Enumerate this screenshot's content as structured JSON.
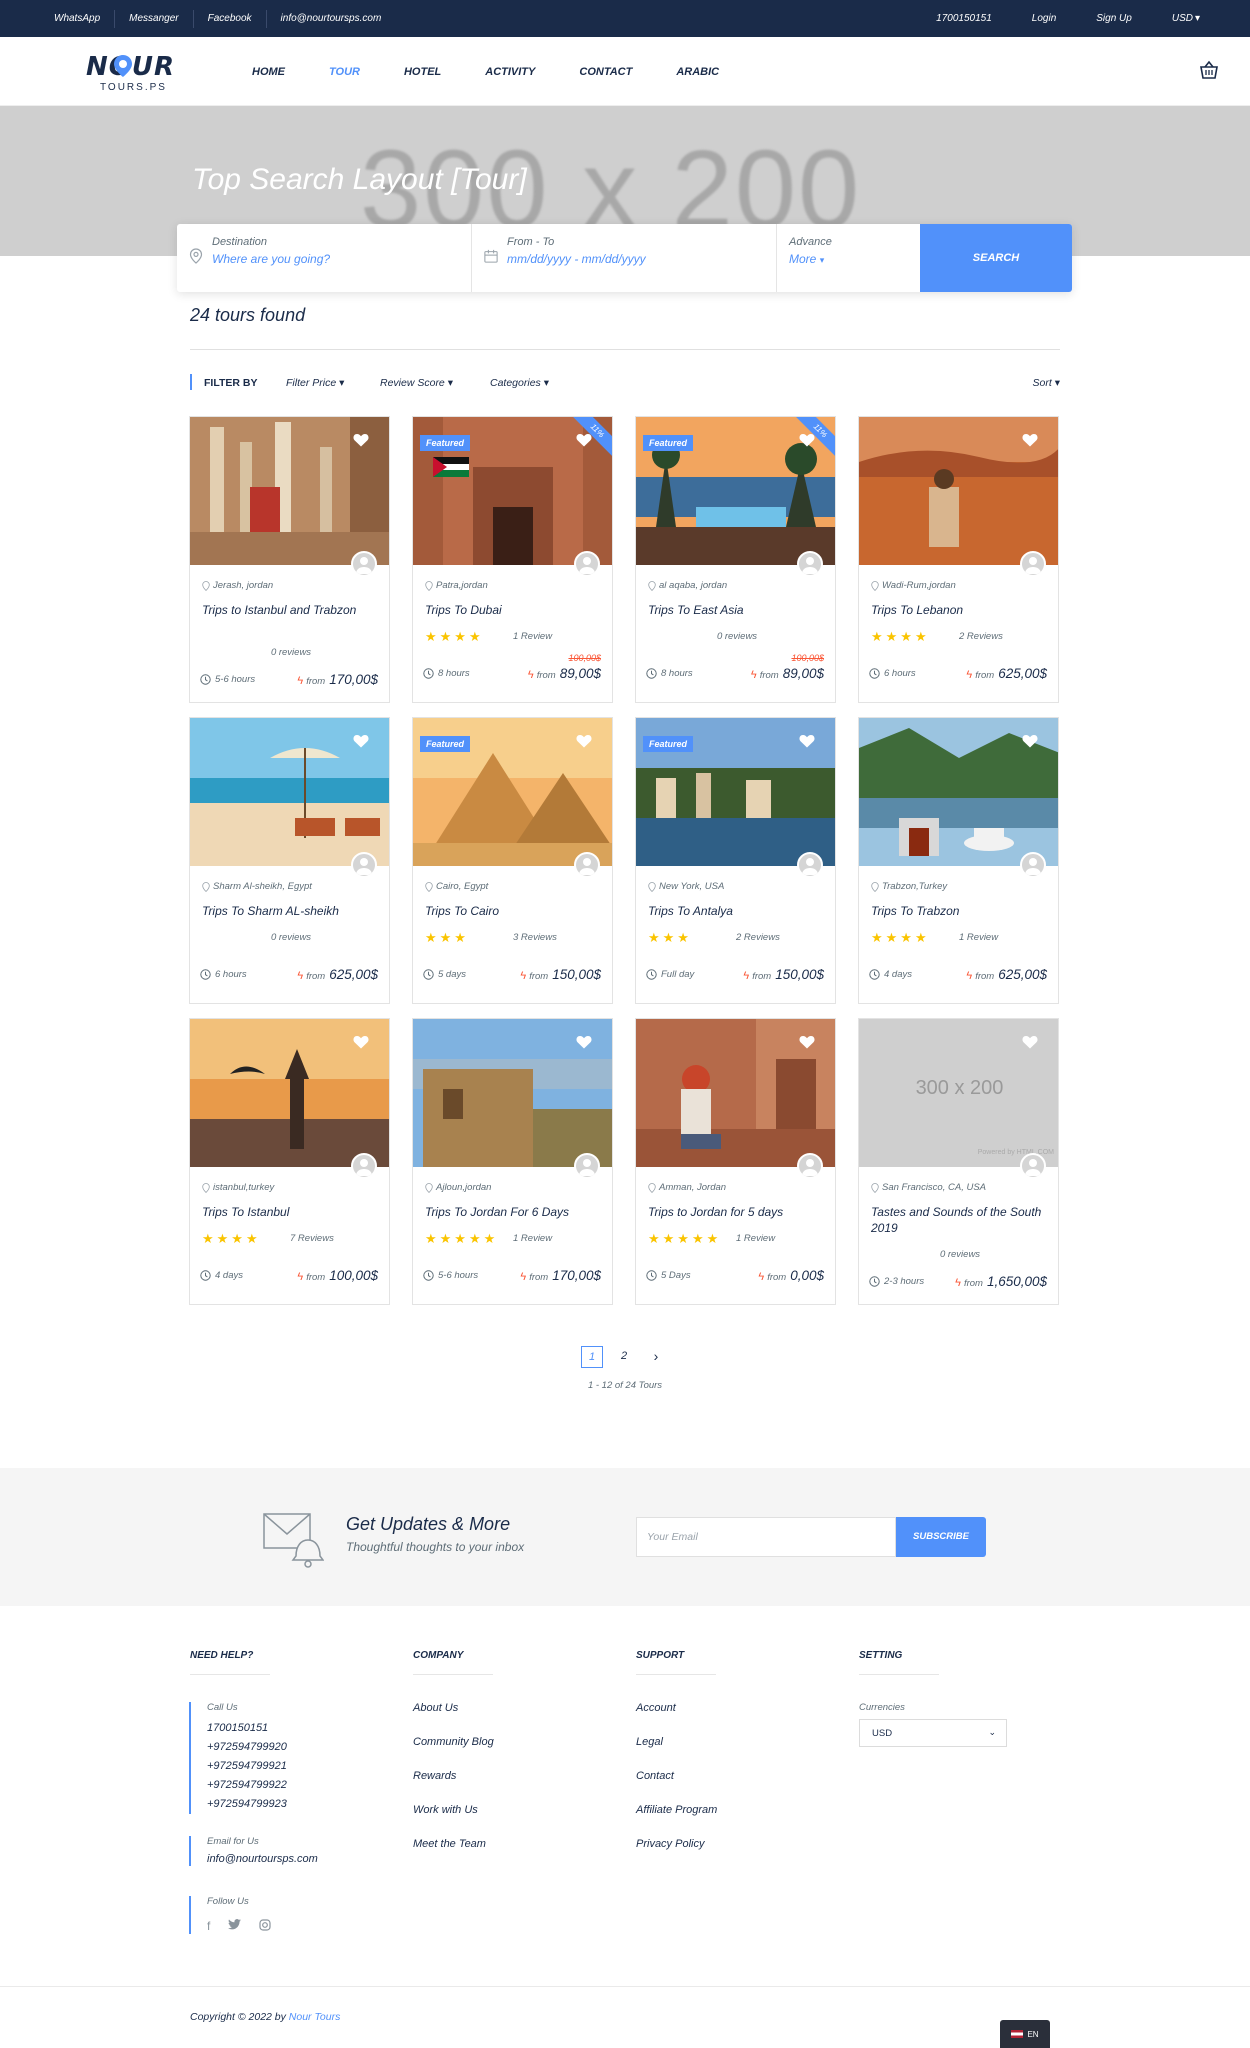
{
  "topbar": {
    "links": [
      "WhatsApp",
      "Messanger",
      "Facebook",
      "info@nourtoursps.com"
    ],
    "phone": "1700150151",
    "login": "Login",
    "signup": "Sign Up",
    "currency": "USD"
  },
  "header": {
    "logo_word": "NOUR",
    "logo_sub": "TOURS.PS",
    "nav": [
      "HOME",
      "TOUR",
      "HOTEL",
      "ACTIVITY",
      "CONTACT",
      "ARABIC"
    ],
    "active_nav": "TOUR"
  },
  "hero": {
    "placeholder": "300 x 200",
    "title": "Top Search Layout [Tour]"
  },
  "search": {
    "destination_label": "Destination",
    "destination_placeholder": "Where are you going?",
    "dates_label": "From - To",
    "dates_value": "mm/dd/yyyy - mm/dd/yyyy",
    "advance_label": "Advance",
    "advance_value": "More",
    "button": "SEARCH"
  },
  "results": {
    "count_text": "24 tours found"
  },
  "filters": {
    "label": "FILTER BY",
    "items": [
      "Filter Price",
      "Review Score",
      "Categories"
    ],
    "sort": "Sort"
  },
  "tours": [
    {
      "location": "Jerash, jordan",
      "title": "Trips to Istanbul and Trabzon",
      "stars": 0,
      "reviews": "0 reviews",
      "duration": "5-6 hours",
      "price": "170,00$",
      "old_price": "",
      "featured": false,
      "discount": ""
    },
    {
      "location": "Patra,jordan",
      "title": "Trips To Dubai",
      "stars": 4,
      "reviews": "1 Review",
      "duration": "8 hours",
      "price": "89,00$",
      "old_price": "100,00$",
      "featured": true,
      "discount": "11%"
    },
    {
      "location": "al aqaba, jordan",
      "title": "Trips To East Asia",
      "stars": 0,
      "reviews": "0 reviews",
      "duration": "8 hours",
      "price": "89,00$",
      "old_price": "100,00$",
      "featured": true,
      "discount": "11%"
    },
    {
      "location": "Wadi-Rum,jordan",
      "title": "Trips To Lebanon",
      "stars": 4,
      "reviews": "2 Reviews",
      "duration": "6 hours",
      "price": "625,00$",
      "old_price": "",
      "featured": false,
      "discount": ""
    },
    {
      "location": "Sharm Al-sheikh, Egypt",
      "title": "Trips To Sharm AL-sheikh",
      "stars": 0,
      "reviews": "0 reviews",
      "duration": "6 hours",
      "price": "625,00$",
      "old_price": "",
      "featured": false,
      "discount": ""
    },
    {
      "location": "Cairo, Egypt",
      "title": "Trips To Cairo",
      "stars": 3,
      "reviews": "3 Reviews",
      "duration": "5 days",
      "price": "150,00$",
      "old_price": "",
      "featured": true,
      "discount": ""
    },
    {
      "location": "New York, USA",
      "title": "Trips To Antalya",
      "stars": 3,
      "reviews": "2 Reviews",
      "duration": "Full day",
      "price": "150,00$",
      "old_price": "",
      "featured": true,
      "discount": ""
    },
    {
      "location": "Trabzon,Turkey",
      "title": "Trips To Trabzon",
      "stars": 4,
      "reviews": "1 Review",
      "duration": "4 days",
      "price": "625,00$",
      "old_price": "",
      "featured": false,
      "discount": ""
    },
    {
      "location": "istanbul,turkey",
      "title": "Trips To Istanbul",
      "stars": 4,
      "reviews": "7 Reviews",
      "duration": "4 days",
      "price": "100,00$",
      "old_price": "",
      "featured": false,
      "discount": ""
    },
    {
      "location": "Ajloun,jordan",
      "title": "Trips To Jordan For 6 Days",
      "stars": 5,
      "reviews": "1 Review",
      "duration": "5-6 hours",
      "price": "170,00$",
      "old_price": "",
      "featured": false,
      "discount": ""
    },
    {
      "location": "Amman, Jordan",
      "title": "Trips to Jordan for 5 days",
      "stars": 5,
      "reviews": "1 Review",
      "duration": "5 Days",
      "price": "0,00$",
      "old_price": "",
      "featured": false,
      "discount": ""
    },
    {
      "location": "San Francisco, CA, USA",
      "title": "Tastes and Sounds of the South 2019",
      "stars": 0,
      "reviews": "0 reviews",
      "duration": "2-3 hours",
      "price": "1,650,00$",
      "old_price": "",
      "featured": false,
      "discount": "",
      "placeholder": "300 x 200",
      "powered": "Powered by HTML.COM"
    }
  ],
  "price_prefix": "from",
  "pagination": {
    "pages": [
      "1",
      "2"
    ],
    "active": "1",
    "next": "›",
    "info": "1 - 12 of 24 Tours"
  },
  "newsletter": {
    "heading": "Get Updates & More",
    "sub": "Thoughtful thoughts to your inbox",
    "placeholder": "Your Email",
    "button": "SUBSCRIBE"
  },
  "footer": {
    "need_help": {
      "heading": "NEED HELP?",
      "call_label": "Call Us",
      "phones": [
        "1700150151",
        "+972594799920",
        "+972594799921",
        "+972594799922",
        "+972594799923"
      ],
      "email_label": "Email for Us",
      "email": "info@nourtoursps.com",
      "follow_label": "Follow Us"
    },
    "company": {
      "heading": "COMPANY",
      "links": [
        "About Us",
        "Community Blog",
        "Rewards",
        "Work with Us",
        "Meet the Team"
      ]
    },
    "support": {
      "heading": "SUPPORT",
      "links": [
        "Account",
        "Legal",
        "Contact",
        "Affiliate Program",
        "Privacy Policy"
      ]
    },
    "setting": {
      "heading": "SETTING",
      "currency_label": "Currencies",
      "currency_value": "USD"
    }
  },
  "copyright": {
    "text": "Copyright © 2022 by",
    "brand": "Nour Tours"
  },
  "language": "EN",
  "colors": {
    "navy": "#1a2b49",
    "accent": "#5191fa",
    "star": "#fac400",
    "price_bolt": "#fa5636"
  }
}
